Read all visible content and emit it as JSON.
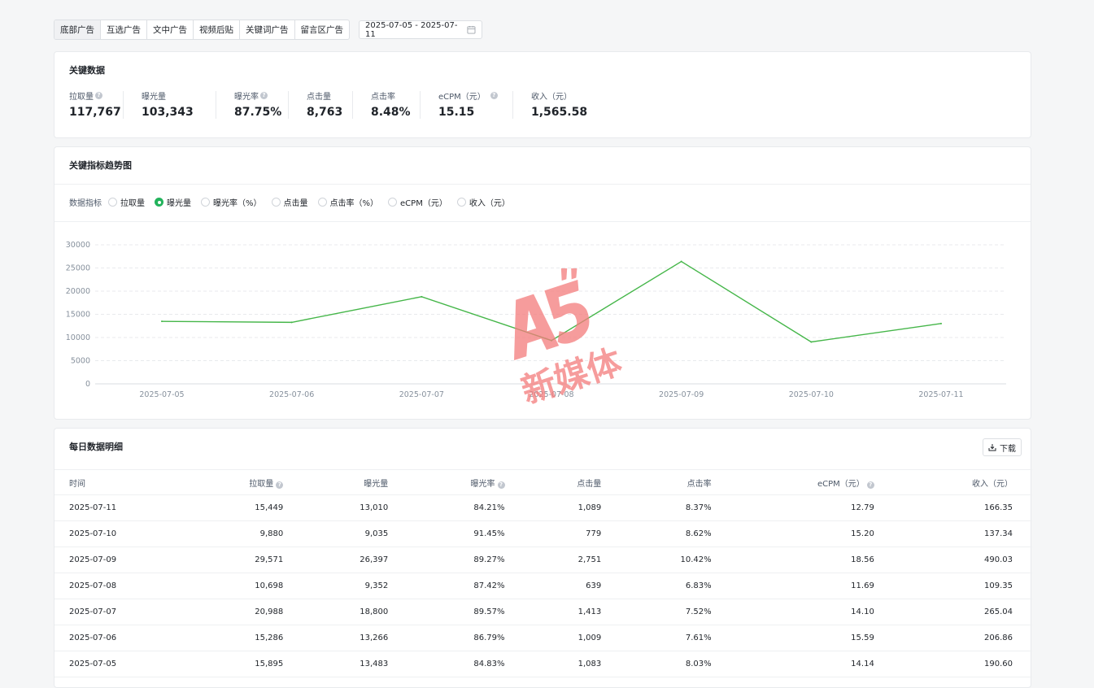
{
  "toolbar": {
    "tabs": [
      "底部广告",
      "互选广告",
      "文中广告",
      "视频后贴",
      "关键词广告",
      "留言区广告"
    ],
    "date_range": "2025-07-05 - 2025-07-11"
  },
  "key_data": {
    "title": "关键数据",
    "metrics": [
      {
        "label": "拉取量",
        "value": "117,767"
      },
      {
        "label": "曝光量",
        "value": "103,343"
      },
      {
        "label": "曝光率",
        "value": "87.75%"
      },
      {
        "label": "点击量",
        "value": "8,763"
      },
      {
        "label": "点击率",
        "value": "8.48%"
      },
      {
        "label": "eCPM（元）",
        "value": "15.15"
      },
      {
        "label": "收入（元）",
        "value": "1,565.58"
      }
    ]
  },
  "trend": {
    "title": "关键指标趋势图",
    "indicator_label": "数据指标",
    "options": [
      "拉取量",
      "曝光量",
      "曝光率（%）",
      "点击量",
      "点击率（%）",
      "eCPM（元）",
      "收入（元）"
    ],
    "selected": "曝光量"
  },
  "chart_data": {
    "type": "line",
    "categories": [
      "2025-07-05",
      "2025-07-06",
      "2025-07-07",
      "2025-07-08",
      "2025-07-09",
      "2025-07-10",
      "2025-07-11"
    ],
    "series": [
      {
        "values": [
          13483,
          13266,
          18800,
          9352,
          26397,
          9035,
          13010
        ]
      }
    ],
    "ylim": [
      0,
      30000
    ],
    "yticks": [
      "30000",
      "25000",
      "20000",
      "15000",
      "10000",
      "5000",
      "0"
    ],
    "grid": true,
    "color": "#45b649"
  },
  "daily": {
    "title": "每日数据明细",
    "download_label": "下载",
    "columns": [
      "时间",
      "拉取量",
      "曝光量",
      "曝光率",
      "点击量",
      "点击率",
      "eCPM（元）",
      "收入（元）"
    ],
    "rows": [
      [
        "2025-07-11",
        "15,449",
        "13,010",
        "84.21%",
        "1,089",
        "8.37%",
        "12.79",
        "166.35"
      ],
      [
        "2025-07-10",
        "9,880",
        "9,035",
        "91.45%",
        "779",
        "8.62%",
        "15.20",
        "137.34"
      ],
      [
        "2025-07-09",
        "29,571",
        "26,397",
        "89.27%",
        "2,751",
        "10.42%",
        "18.56",
        "490.03"
      ],
      [
        "2025-07-08",
        "10,698",
        "9,352",
        "87.42%",
        "639",
        "6.83%",
        "11.69",
        "109.35"
      ],
      [
        "2025-07-07",
        "20,988",
        "18,800",
        "89.57%",
        "1,413",
        "7.52%",
        "14.10",
        "265.04"
      ],
      [
        "2025-07-06",
        "15,286",
        "13,266",
        "86.79%",
        "1,009",
        "7.61%",
        "15.59",
        "206.86"
      ],
      [
        "2025-07-05",
        "15,895",
        "13,483",
        "84.83%",
        "1,083",
        "8.03%",
        "14.14",
        "190.60"
      ]
    ]
  },
  "watermark": {
    "logo": "A5",
    "text": "新媒体"
  }
}
